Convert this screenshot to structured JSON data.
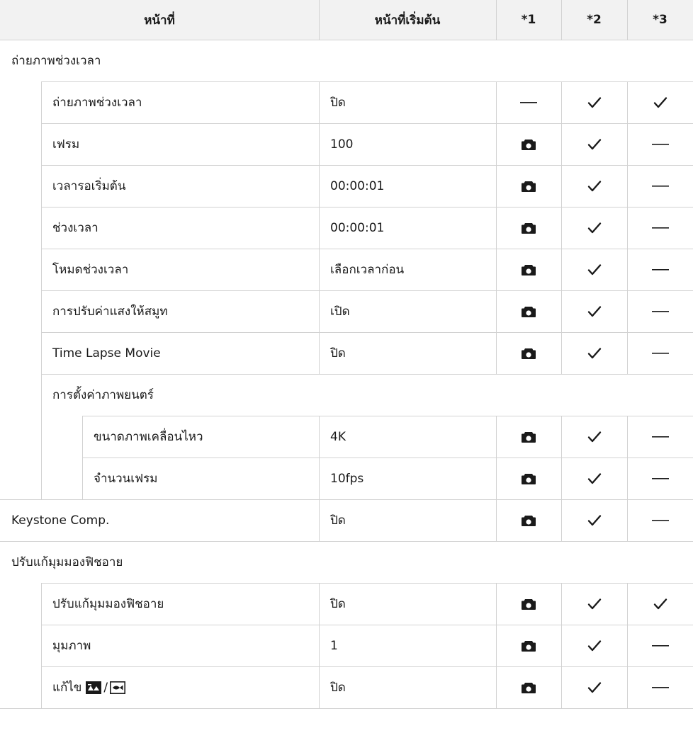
{
  "header": {
    "function": "หน้าที่",
    "default": "หน้าที่เริ่มต้น",
    "col1": "*1",
    "col2": "*2",
    "col3": "*3"
  },
  "rows": [
    {
      "kind": "group",
      "level": 0,
      "label": "ถ่ายภาพช่วงเวลา"
    },
    {
      "kind": "item",
      "level": 1,
      "label": "ถ่ายภาพช่วงเวลา",
      "value": "ปิด",
      "c1": "dash",
      "c2": "check",
      "c3": "check"
    },
    {
      "kind": "item",
      "level": 1,
      "label": "เฟรม",
      "value": "100",
      "c1": "camera",
      "c2": "check",
      "c3": "dash"
    },
    {
      "kind": "item",
      "level": 1,
      "label": "เวลารอเริ่มต้น",
      "value": "00:00:01",
      "c1": "camera",
      "c2": "check",
      "c3": "dash"
    },
    {
      "kind": "item",
      "level": 1,
      "label": "ช่วงเวลา",
      "value": "00:00:01",
      "c1": "camera",
      "c2": "check",
      "c3": "dash"
    },
    {
      "kind": "item",
      "level": 1,
      "label": "โหมดช่วงเวลา",
      "value": "เลือกเวลาก่อน",
      "c1": "camera",
      "c2": "check",
      "c3": "dash"
    },
    {
      "kind": "item",
      "level": 1,
      "label": "การปรับค่าแสงให้สมูท",
      "value": "เปิด",
      "c1": "camera",
      "c2": "check",
      "c3": "dash"
    },
    {
      "kind": "item",
      "level": 1,
      "label": "Time Lapse Movie",
      "value": "ปิด",
      "c1": "camera",
      "c2": "check",
      "c3": "dash"
    },
    {
      "kind": "group",
      "level": 1,
      "label": "การตั้งค่าภาพยนตร์"
    },
    {
      "kind": "item",
      "level": 2,
      "label": "ขนาดภาพเคลื่อนไหว",
      "value": "4K",
      "c1": "camera",
      "c2": "check",
      "c3": "dash"
    },
    {
      "kind": "item",
      "level": 2,
      "label": "จำนวนเฟรม",
      "value": "10fps",
      "c1": "camera",
      "c2": "check",
      "c3": "dash"
    },
    {
      "kind": "item",
      "level": 0,
      "label": "Keystone Comp.",
      "value": "ปิด",
      "c1": "camera",
      "c2": "check",
      "c3": "dash"
    },
    {
      "kind": "group",
      "level": 0,
      "label": "ปรับแก้มุมมองฟิชอาย"
    },
    {
      "kind": "item",
      "level": 1,
      "label": "ปรับแก้มุมมองฟิชอาย",
      "value": "ปิด",
      "c1": "camera",
      "c2": "check",
      "c3": "check"
    },
    {
      "kind": "item",
      "level": 1,
      "label": "มุมภาพ",
      "value": "1",
      "c1": "camera",
      "c2": "check",
      "c3": "dash"
    },
    {
      "kind": "item",
      "level": 1,
      "label": "แก้ไข",
      "label_icons": [
        "fisheye-tele-icon",
        "fisheye-wide-icon"
      ],
      "label_sep": "/",
      "value": "ปิด",
      "c1": "camera",
      "c2": "check",
      "c3": "dash"
    }
  ],
  "icons": {
    "camera": "camera-icon",
    "check": "check-icon",
    "dash": "dash-icon"
  },
  "colors": {
    "header_bg": "#f2f2f2",
    "grid": "#d2d2d2",
    "text": "#1a1a1a"
  }
}
